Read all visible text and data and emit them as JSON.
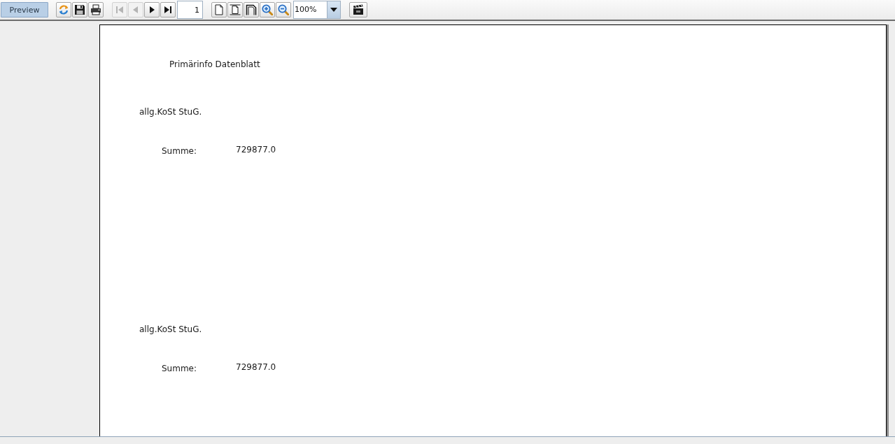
{
  "toolbar": {
    "preview_button": {
      "label": "Preview",
      "selected": true
    },
    "file_buttons": [
      {
        "kind": "refresh"
      },
      {
        "kind": "save"
      },
      {
        "kind": "print"
      }
    ],
    "nav_buttons": [
      {
        "kind": "first",
        "disabled": true
      },
      {
        "kind": "previous",
        "disabled": true
      },
      {
        "kind": "next",
        "disabled": false
      },
      {
        "kind": "last",
        "disabled": false
      }
    ],
    "page_field": {
      "value": "1"
    },
    "view_buttons": [
      {
        "kind": "single-page"
      },
      {
        "kind": "page-width"
      },
      {
        "kind": "full-page"
      },
      {
        "kind": "zoom-in"
      },
      {
        "kind": "zoom-out"
      }
    ],
    "zoom_select": {
      "value": "100%"
    },
    "extra_buttons": [
      {
        "kind": "clapperboard"
      }
    ]
  },
  "report": {
    "title": "Primärinfo Datenblatt",
    "groups": [
      {
        "heading": "allg.KoSt StuG.",
        "sum_label": "Summe:",
        "sum_value": "729877.0"
      },
      {
        "heading": "allg.KoSt StuG.",
        "sum_label": "Summe:",
        "sum_value": "729877.0"
      }
    ]
  }
}
